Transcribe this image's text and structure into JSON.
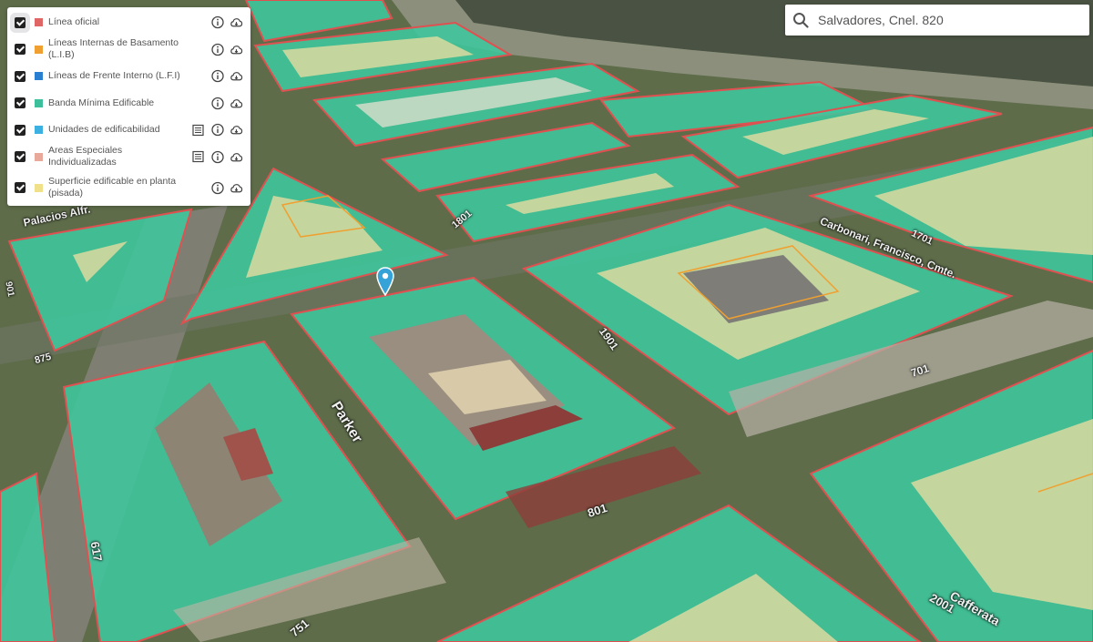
{
  "layers": [
    {
      "label": "Línea oficial",
      "color": "#e06666",
      "has_legend": false
    },
    {
      "label": "Líneas Internas de Basamento (L.I.B)",
      "color": "#f0a030",
      "has_legend": false
    },
    {
      "label": "Líneas de Frente Interno (L.F.I)",
      "color": "#2a7fd0",
      "has_legend": false
    },
    {
      "label": "Banda Mínima Edificable",
      "color": "#3cbf9a",
      "has_legend": false
    },
    {
      "label": "Unidades de edificabilidad",
      "color": "#3cb0e0",
      "has_legend": true
    },
    {
      "label": "Areas Especiales Individualizadas",
      "color": "#e8a89a",
      "has_legend": true
    },
    {
      "label": "Superficie edificable en planta (pisada)",
      "color": "#f0e08a",
      "has_legend": false
    }
  ],
  "search": {
    "value": "Salvadores, Cnel. 820"
  },
  "map_labels": {
    "street_parker": "Parker",
    "street_palacios": "Palacios Alfr.",
    "street_cafferata": "Cafferata",
    "street_carbonari": "Carbonari, Francisco, Cmte.",
    "num_1701": "1701",
    "num_1901": "1901",
    "num_1801": "1801",
    "num_801": "801",
    "num_701": "701",
    "num_875": "875",
    "num_617": "617",
    "num_2001": "2001",
    "num_901": "901",
    "num_751": "751"
  },
  "colors": {
    "zone_fill": "#3ccaa0",
    "official_line": "#e05050",
    "built_area": "#f0dfa0",
    "river": "#4a5343"
  }
}
